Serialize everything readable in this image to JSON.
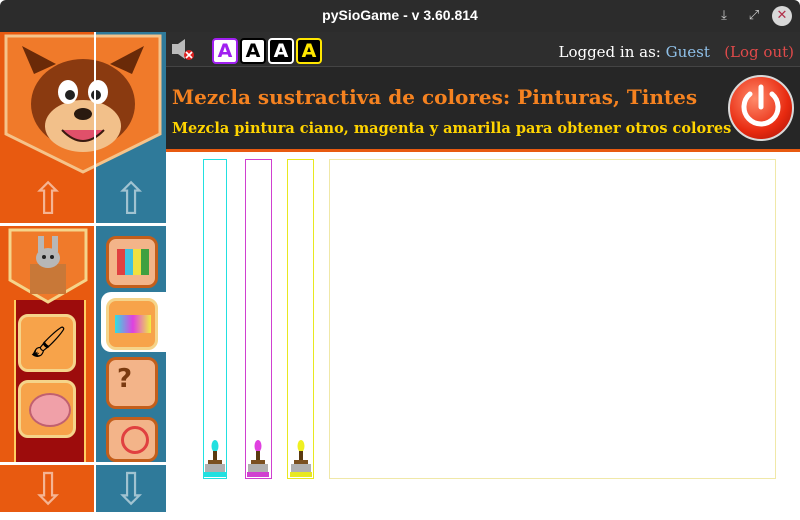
{
  "window": {
    "title": "pySioGame - v 3.60.814",
    "minimize_icon": "download-icon",
    "maximize_icon": "expand-icon",
    "close_icon": "close-icon"
  },
  "topbar": {
    "font_buttons": [
      "A",
      "A",
      "A",
      "A"
    ],
    "logged_in_label": "Logged in as:",
    "user": "Guest",
    "logout": "(Log out)"
  },
  "header": {
    "title": "Mezcla sustractiva de colores: Pinturas, Tintes",
    "subtitle": "Mezcla pintura ciano, magenta y amarilla para obtener otros colores"
  },
  "colors": {
    "cyan": "#22e0e0",
    "magenta": "#d040d0",
    "yellow": "#e8e820",
    "accent": "#e85a10",
    "title_orange": "#f58220",
    "subtitle_yellow": "#ffd400"
  },
  "sidebar": {
    "categories": [
      "paint-tube-icon",
      "brain-icon"
    ],
    "games": [
      "paint-tubes-icon",
      "paint-mix-icon",
      "paint-quiz-icon",
      "color-wheel-icon"
    ]
  }
}
